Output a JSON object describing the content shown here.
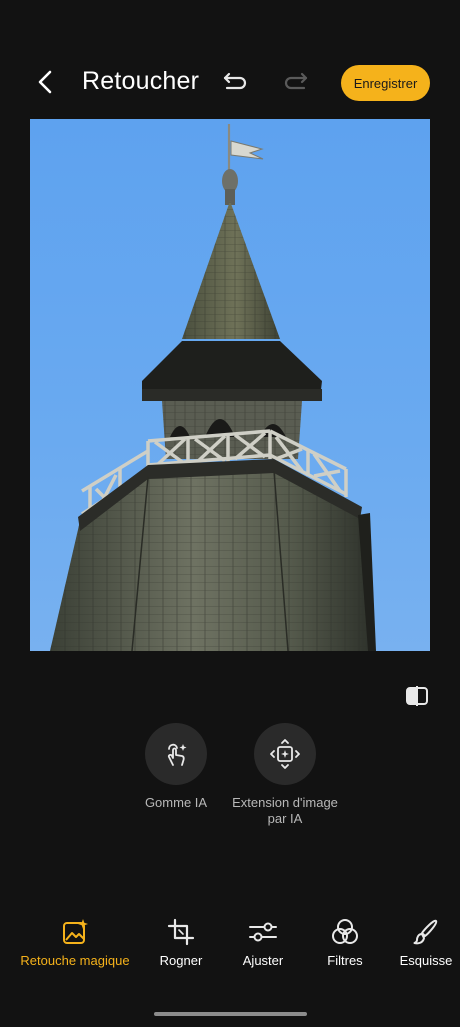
{
  "header": {
    "title": "Retoucher",
    "save_label": "Enregistrer"
  },
  "ai_tools": [
    {
      "label": "Gomme IA"
    },
    {
      "label": "Extension d'image par IA"
    }
  ],
  "toolbar": {
    "items": [
      {
        "label": "Retouche magique",
        "icon": "magic-retouch-icon",
        "active": true
      },
      {
        "label": "Rogner",
        "icon": "crop-icon",
        "active": false
      },
      {
        "label": "Ajuster",
        "icon": "sliders-icon",
        "active": false
      },
      {
        "label": "Filtres",
        "icon": "filters-icon",
        "active": false
      },
      {
        "label": "Esquisse",
        "icon": "brush-icon",
        "active": false
      }
    ]
  },
  "colors": {
    "accent": "#f5b21b",
    "background": "#121212",
    "sky": "#6aaaf0"
  }
}
